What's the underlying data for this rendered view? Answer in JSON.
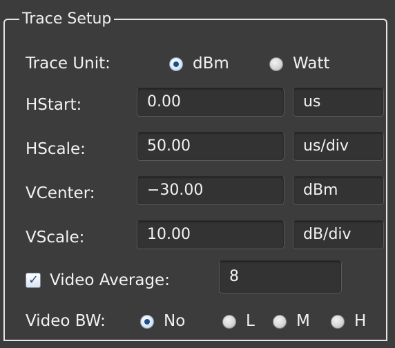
{
  "group": {
    "title": "Trace Setup"
  },
  "trace_unit": {
    "label": "Trace Unit:",
    "options": [
      {
        "label": "dBm",
        "selected": true
      },
      {
        "label": "Watt",
        "selected": false
      }
    ]
  },
  "rows": [
    {
      "label": "HStart:",
      "value": "0.00",
      "unit": "us"
    },
    {
      "label": "HScale:",
      "value": "50.00",
      "unit": "us/div"
    },
    {
      "label": "VCenter:",
      "value": "−30.00",
      "unit": "dBm"
    },
    {
      "label": "VScale:",
      "value": "10.00",
      "unit": "dB/div"
    }
  ],
  "video_average": {
    "label": "Video Average:",
    "checked": true,
    "value": "8"
  },
  "video_bw": {
    "label": "Video BW:",
    "options": [
      {
        "label": "No",
        "selected": true
      },
      {
        "label": "L",
        "selected": false
      },
      {
        "label": "M",
        "selected": false
      },
      {
        "label": "H",
        "selected": false
      }
    ]
  },
  "colors": {
    "background": "#3c3c3c",
    "text": "#f2f2f2",
    "field_bg": "#333333",
    "radio_dot": "#1b4f8c"
  }
}
